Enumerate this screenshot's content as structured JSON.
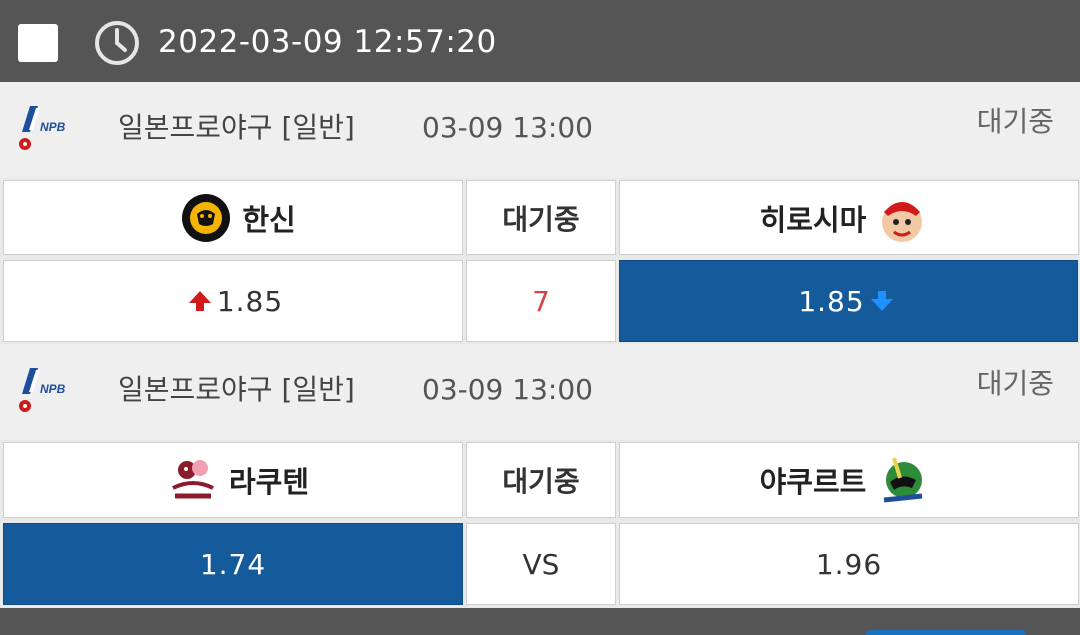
{
  "topbar": {
    "datetime": "2022-03-09 12:57:20",
    "checkbox_icon": "checkbox-icon",
    "clock_icon": "clock-icon"
  },
  "matches": [
    {
      "league": "일본프로야구 [일반]",
      "time": "03-09 13:00",
      "status": "대기중",
      "home": {
        "name": "한신",
        "logo": "hanshin-tigers-logo",
        "odds": "1.85",
        "trend": "up",
        "selected": false
      },
      "middle": {
        "label": "대기중",
        "value": "7"
      },
      "away": {
        "name": "히로시마",
        "logo": "hiroshima-carp-logo",
        "odds": "1.85",
        "trend": "down",
        "selected": true
      }
    },
    {
      "league": "일본프로야구 [일반]",
      "time": "03-09 13:00",
      "status": "대기중",
      "home": {
        "name": "라쿠텐",
        "logo": "rakuten-eagles-logo",
        "odds": "1.74",
        "selected": true
      },
      "middle": {
        "label": "대기중",
        "value": "VS"
      },
      "away": {
        "name": "야쿠르트",
        "logo": "yakult-swallows-logo",
        "odds": "1.96",
        "selected": false
      }
    }
  ],
  "colors": {
    "selected": "#155a9b",
    "up_arrow": "#d11a1a",
    "down_arrow": "#1e90ff",
    "count": "#d64545"
  }
}
